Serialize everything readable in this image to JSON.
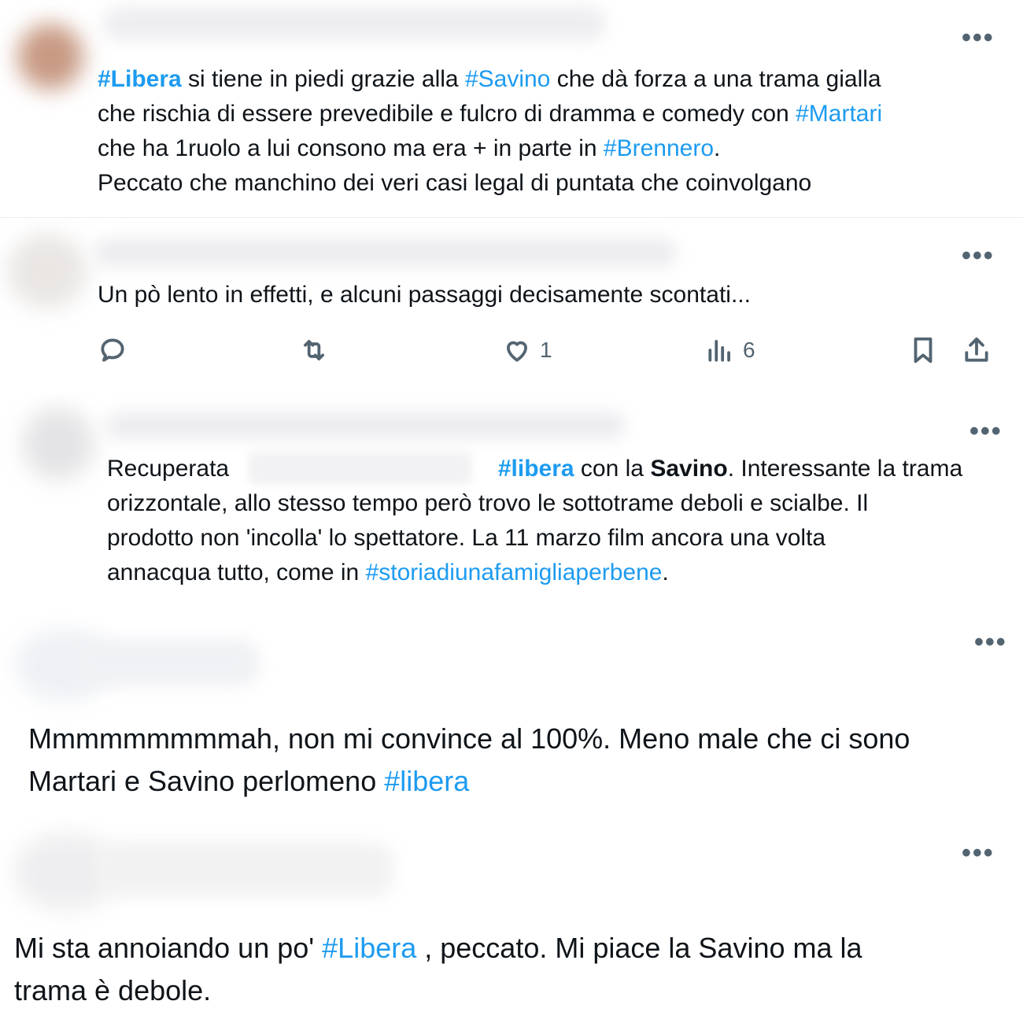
{
  "posts": [
    {
      "menu_label": "•••",
      "lines": [
        [
          {
            "t": "#Libera",
            "c": "tag b"
          },
          {
            "t": " si tiene in piedi grazie alla "
          },
          {
            "t": "#Savino",
            "c": "tag"
          },
          {
            "t": " che dà forza a una trama gialla"
          }
        ],
        [
          {
            "t": "che rischia di essere prevedibile e fulcro di dramma e comedy con "
          },
          {
            "t": "#Martari",
            "c": "tag"
          }
        ],
        [
          {
            "t": "che ha 1ruolo a lui consono ma era + in parte in "
          },
          {
            "t": "#Brennero",
            "c": "tag"
          },
          {
            "t": "."
          }
        ],
        [
          {
            "t": "Peccato che manchino dei veri casi legal di puntata che coinvolgano"
          }
        ]
      ]
    },
    {
      "menu_label": "•••",
      "lines": [
        [
          {
            "t": "Un pò lento in effetti, e alcuni passaggi decisamente scontati..."
          }
        ]
      ],
      "actions": {
        "like_count": "1",
        "views_count": "6"
      }
    },
    {
      "menu_label": "•••",
      "lines": [
        [
          {
            "t": "Recuperata "
          },
          {
            "t": "                                        "
          },
          {
            "t": "#libera",
            "c": "tag b"
          },
          {
            "t": " con la "
          },
          {
            "t": "Savino",
            "c": "b"
          },
          {
            "t": ". Interessante la trama"
          }
        ],
        [
          {
            "t": "orizzontale, allo stesso tempo però trovo le sottotrame deboli e scialbe. Il"
          }
        ],
        [
          {
            "t": "prodotto non 'incolla' lo spettatore. La 11 marzo film ancora una volta"
          }
        ],
        [
          {
            "t": "annacqua tutto, come in "
          },
          {
            "t": "#storiadiunafamigliaperbene",
            "c": "tag"
          },
          {
            "t": "."
          }
        ]
      ]
    },
    {
      "menu_label": "•••",
      "lines": [
        [
          {
            "t": "Mmmmmmmmmah, non mi convince al 100%. Meno male che ci sono"
          }
        ],
        [
          {
            "t": "Martari e Savino perlomeno "
          },
          {
            "t": "#libera",
            "c": "tag"
          }
        ]
      ]
    },
    {
      "menu_label": "•••",
      "lines": [
        [
          {
            "t": "Mi sta annoiando un po' "
          },
          {
            "t": "#Libera",
            "c": "tag"
          },
          {
            "t": " , peccato. Mi piace la Savino ma la"
          }
        ],
        [
          {
            "t": "trama è debole."
          }
        ]
      ]
    }
  ],
  "colors": {
    "hashtag": "#1d9bf0",
    "muted": "#536471",
    "text": "#0f1419"
  },
  "icons": [
    "reply-icon",
    "retweet-icon",
    "heart-icon",
    "views-icon",
    "bookmark-icon",
    "share-icon"
  ]
}
